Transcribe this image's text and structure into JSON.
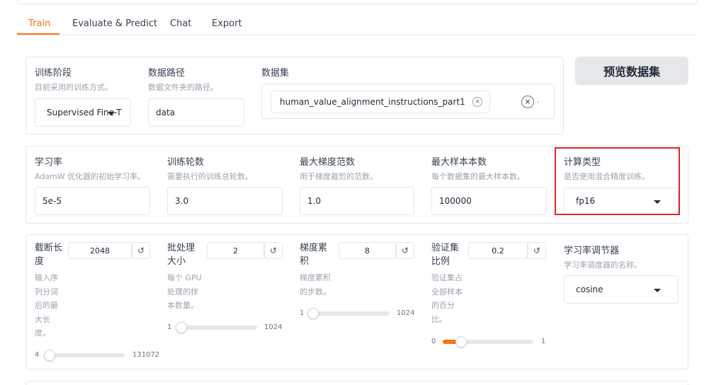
{
  "tabs": [
    "Train",
    "Evaluate & Predict",
    "Chat",
    "Export"
  ],
  "row1": {
    "stage": {
      "label": "训练阶段",
      "info": "目前采用的训练方式。",
      "value": "Supervised Fine-T"
    },
    "data_dir": {
      "label": "数据路径",
      "info": "数据文件夹的路径。",
      "value": "data"
    },
    "dataset": {
      "label": "数据集",
      "chip": "human_value_alignment_instructions_part1",
      "chip_close": "×",
      "clear": "×",
      "dot": "·"
    },
    "preview_button": "预览数据集"
  },
  "row2": {
    "lr": {
      "label": "学习率",
      "info": "AdamW 优化器的初始学习率。",
      "value": "5e-5"
    },
    "epochs": {
      "label": "训练轮数",
      "info": "需要执行的训练总轮数。",
      "value": "3.0"
    },
    "max_grad_norm": {
      "label": "最大梯度范数",
      "info": "用于梯度裁剪的范数。",
      "value": "1.0"
    },
    "max_samples": {
      "label": "最大样本本数",
      "info": "每个数据集的最大样本数。",
      "value": "100000"
    },
    "compute_type": {
      "label": "计算类型",
      "info": "是否使用混合精度训练。",
      "value": "fp16"
    }
  },
  "row3": {
    "cutoff": {
      "label": [
        "截断长",
        "度"
      ],
      "info": [
        "输入序",
        "列分词",
        "后的最",
        "大长",
        "度。"
      ],
      "value": "2048",
      "min": "4",
      "max": "131072",
      "fraction": 0.0
    },
    "batch": {
      "label": [
        "批处理",
        "大小"
      ],
      "info": [
        "每个 GPU",
        "处理的样",
        "本数量。"
      ],
      "value": "2",
      "min": "1",
      "max": "1024",
      "fraction": 0.001
    },
    "grad_accum": {
      "label": [
        "梯度累",
        "积"
      ],
      "info": [
        "梯度累积",
        "的步数。"
      ],
      "value": "8",
      "min": "1",
      "max": "1024",
      "fraction": 0.007
    },
    "val_size": {
      "label": [
        "验证集",
        "比例"
      ],
      "info": [
        "验证集占",
        "全部样本",
        "的百分",
        "比。"
      ],
      "value": "0.2",
      "min": "0",
      "max": "1",
      "fraction": 0.2
    },
    "scheduler": {
      "label": "学习率调节器",
      "info": "学习率调度器的名称。",
      "value": "cosine"
    },
    "reset_icon": "↺"
  }
}
